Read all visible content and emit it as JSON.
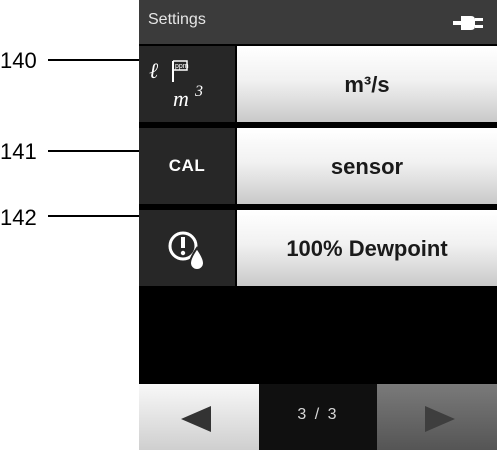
{
  "header": {
    "title": "Settings",
    "power_icon": "plug-icon"
  },
  "settings": [
    {
      "icon": "flow-unit-icon",
      "value": "m³/s"
    },
    {
      "icon_text": "CAL",
      "value": "sensor"
    },
    {
      "icon": "dewpoint-alarm-icon",
      "value": "100% Dewpoint"
    }
  ],
  "pager": {
    "page": "3 / 3",
    "prev_icon": "arrow-left-icon",
    "next_icon": "arrow-right-icon"
  },
  "callouts": [
    "140",
    "141",
    "142"
  ]
}
